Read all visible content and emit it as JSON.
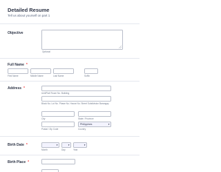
{
  "header": {
    "title": "Detailed Resume",
    "subtitle": "Tell us about yourself on part 1"
  },
  "objective": {
    "label": "Objective",
    "sublabel": "Optional"
  },
  "full_name": {
    "label": "Full Name",
    "required_mark": "*",
    "sublabels": [
      "First Name",
      "Middle Name",
      "Last Name",
      "Suffix"
    ]
  },
  "address": {
    "label": "Address",
    "required_mark": "*",
    "unit_label": "Unit/Flat/ Room No. Building",
    "street_label": "Block No. Lot No. Phase No. House No. Street Subdivision Barangay",
    "city_label": "City",
    "state_label": "State / Province",
    "postal_label": "Postal / Zip Code",
    "country_label": "Country",
    "country_value": "Philippines"
  },
  "birth_date": {
    "label": "Birth Date",
    "required_mark": "*",
    "month_label": "Month",
    "day_label": "Day",
    "year_label": "Year"
  },
  "birth_place": {
    "label": "Birth Place",
    "required_mark": "*"
  },
  "icons": {
    "dropdown": "chevron-down-icon",
    "resize": "resize-handle-icon"
  },
  "colors": {
    "required": "#f23a3c",
    "title": "#2c3345",
    "border": "#b8bdc9",
    "select_bg": "#f3f3fe"
  }
}
